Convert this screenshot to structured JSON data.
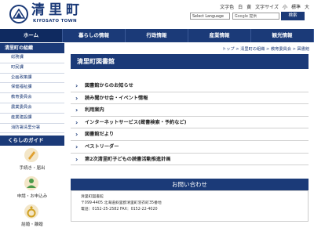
{
  "header": {
    "site_title": "清里町",
    "site_subtitle": "KIYOSATO TOWN",
    "util_links": [
      "文字色",
      "白",
      "黄",
      "文字サイズ",
      "小",
      "標準",
      "大"
    ],
    "language_select": "Select Language",
    "search_placeholder": "Google 提供",
    "search_button": "検索"
  },
  "nav": {
    "items": [
      "ホーム",
      "暮らしの情報",
      "行政情報",
      "産業情報",
      "観光情報"
    ]
  },
  "sidebar": {
    "heading": "清里町の組織",
    "items": [
      "総務課",
      "町民課",
      "企画政策課",
      "保健福祉課",
      "教育委員会",
      "農業委員会",
      "産業建設課",
      "消防署清里分署"
    ],
    "guide_heading": "くらしのガイド",
    "guide_items": [
      "手続き・届出",
      "申請・お申込み",
      "結婚・離婚"
    ]
  },
  "breadcrumb": "トップ > 清里町の組織 > 教育委員会 > 図書館",
  "page_title": "清里町図書館",
  "menu": {
    "items": [
      "図書館からのお知らせ",
      "読み聞かせ会・イベント情報",
      "利用案内",
      "インターネットサービス(蔵書検索・予約など)",
      "図書館だより",
      "ベストリーダー",
      "第2次清里町子どもの読書活動推進計画"
    ]
  },
  "contact": {
    "heading": "お問い合わせ",
    "name": "清里町図書館",
    "address": "〒099-4405 北海道斜里郡清里町羽衣町35番地",
    "phone": "電話：0152-25-2582 FAX：0152-22-4020"
  },
  "colors": {
    "brand": "#1b3a78"
  }
}
